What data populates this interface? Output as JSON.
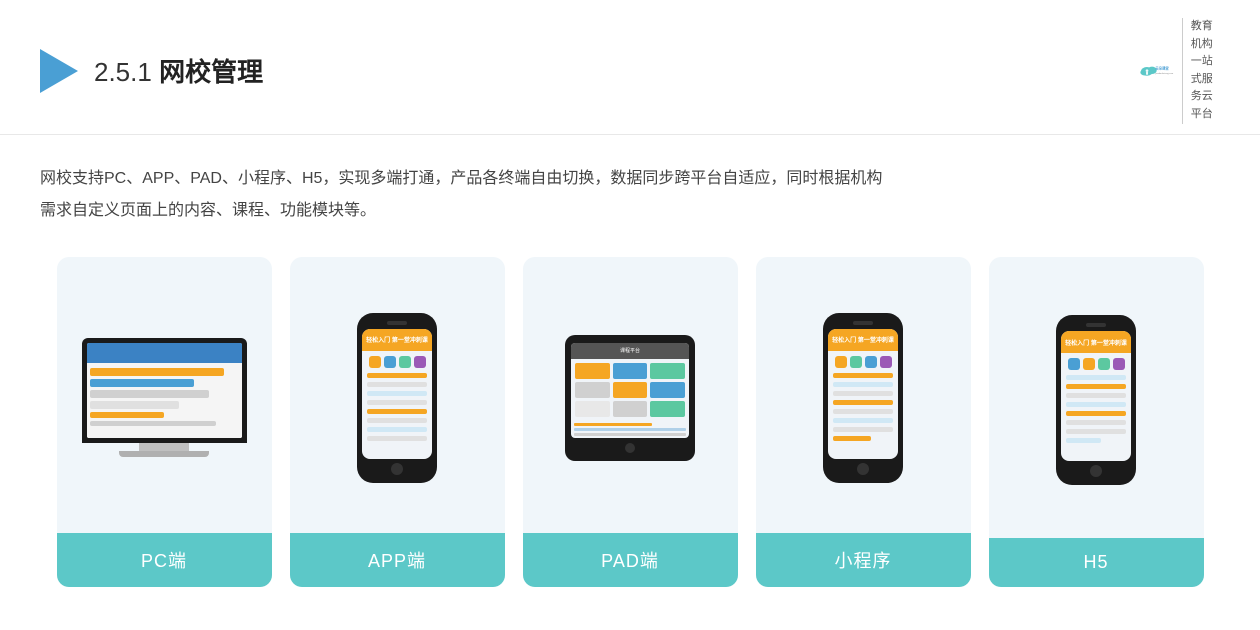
{
  "header": {
    "section_number": "2.5.1",
    "title": "网校管理",
    "logo_url": "yunduoketang.com",
    "logo_tagline_1": "教育机构一站",
    "logo_tagline_2": "式服务云平台"
  },
  "description": {
    "line1": "网校支持PC、APP、PAD、小程序、H5，实现多端打通，产品各终端自由切换，数据同步跨平台自适应，同时根据机构",
    "line2": "需求自定义页面上的内容、课程、功能模块等。"
  },
  "cards": [
    {
      "id": "pc",
      "label": "PC端"
    },
    {
      "id": "app",
      "label": "APP端"
    },
    {
      "id": "pad",
      "label": "PAD端"
    },
    {
      "id": "miniprogram",
      "label": "小程序"
    },
    {
      "id": "h5",
      "label": "H5"
    }
  ]
}
